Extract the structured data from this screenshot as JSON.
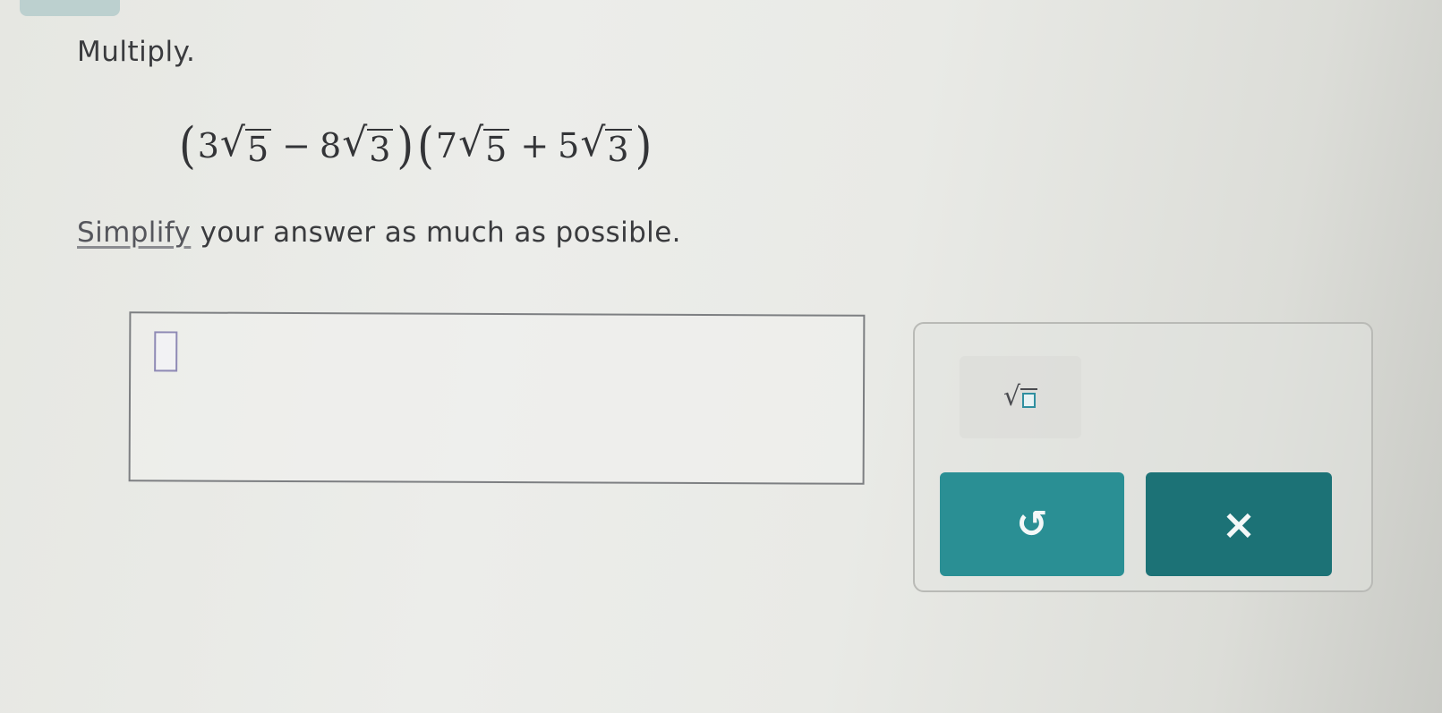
{
  "problem": {
    "prompt": "Multiply.",
    "expression": {
      "open_paren_1": "(",
      "term1_coef": "3",
      "term1_radicand": "5",
      "term1_op": "−",
      "term2_coef": "8",
      "term2_radicand": "3",
      "close_paren_1": ")",
      "open_paren_2": "(",
      "term3_coef": "7",
      "term3_radicand": "5",
      "term3_op": "+",
      "term4_coef": "5",
      "term4_radicand": "3",
      "close_paren_2": ")",
      "radical_symbol": "√"
    },
    "instruction_link": "Simplify",
    "instruction_rest": " your answer as much as possible."
  },
  "answer": {
    "value": ""
  },
  "keypad": {
    "sqrt_key_icon": "square-root-template-icon",
    "sqrt_key_symbol": "√",
    "undo_icon": "undo-icon",
    "undo_glyph": "↺",
    "clear_icon": "close-icon",
    "clear_glyph": "×",
    "colors": {
      "undo_bg": "#2a8f94",
      "clear_bg": "#1c7276"
    }
  }
}
